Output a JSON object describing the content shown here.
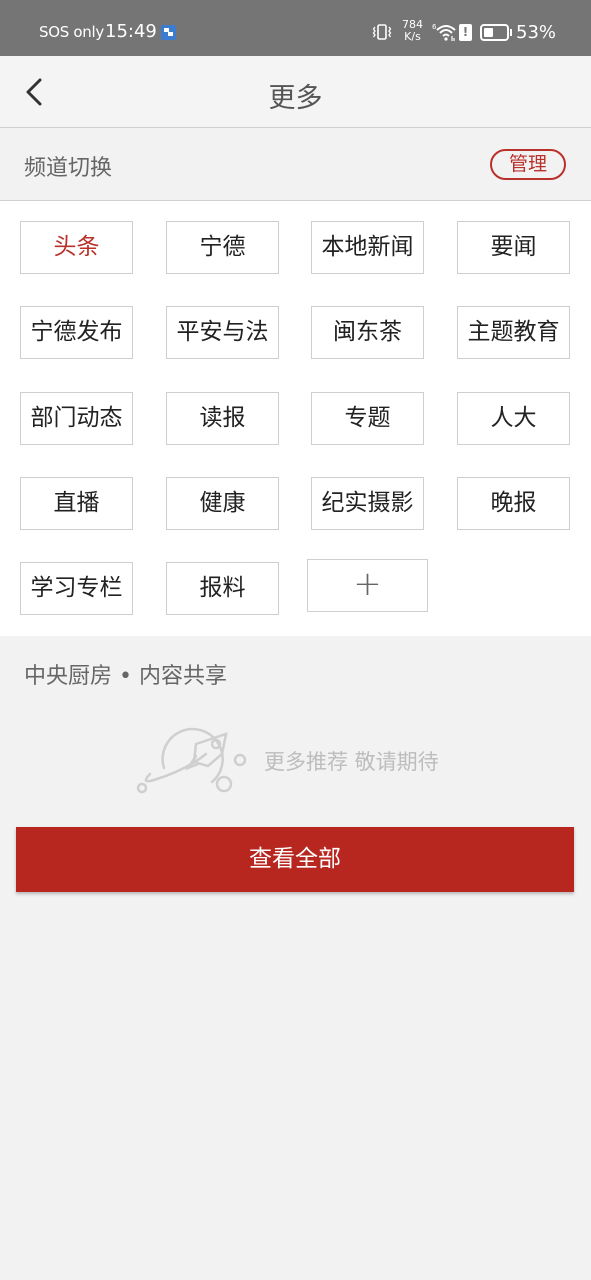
{
  "status_bar": {
    "carrier": "SOS only",
    "time": "15:49",
    "net_speed_value": "784",
    "net_speed_unit": "K/s",
    "wifi_label": "6",
    "sim_alert": "!",
    "battery_percent": "53%",
    "battery_level": 0.53
  },
  "header": {
    "back_icon": "chevron-left-icon",
    "title": "更多"
  },
  "channel_section": {
    "title": "频道切换",
    "manage_label": "管理",
    "channels": [
      {
        "label": "头条",
        "active": true
      },
      {
        "label": "宁德"
      },
      {
        "label": "本地新闻"
      },
      {
        "label": "要闻"
      },
      {
        "label": "宁德发布"
      },
      {
        "label": "平安与法"
      },
      {
        "label": "闽东茶"
      },
      {
        "label": "主题教育"
      },
      {
        "label": "部门动态"
      },
      {
        "label": "读报"
      },
      {
        "label": "专题"
      },
      {
        "label": "人大"
      },
      {
        "label": "直播"
      },
      {
        "label": "健康"
      },
      {
        "label": "纪实摄影"
      },
      {
        "label": "晚报"
      },
      {
        "label": "学习专栏"
      },
      {
        "label": "报料"
      }
    ],
    "add_label": "+"
  },
  "shared_section": {
    "title": "中央厨房 • 内容共享",
    "empty_icon": "rocket-planet-icon",
    "empty_text": "更多推荐 敬请期待",
    "view_all_label": "查看全部"
  },
  "colors": {
    "accent": "#b8271f",
    "status_bar_bg": "#757575",
    "page_bg": "#f2f2f2"
  }
}
